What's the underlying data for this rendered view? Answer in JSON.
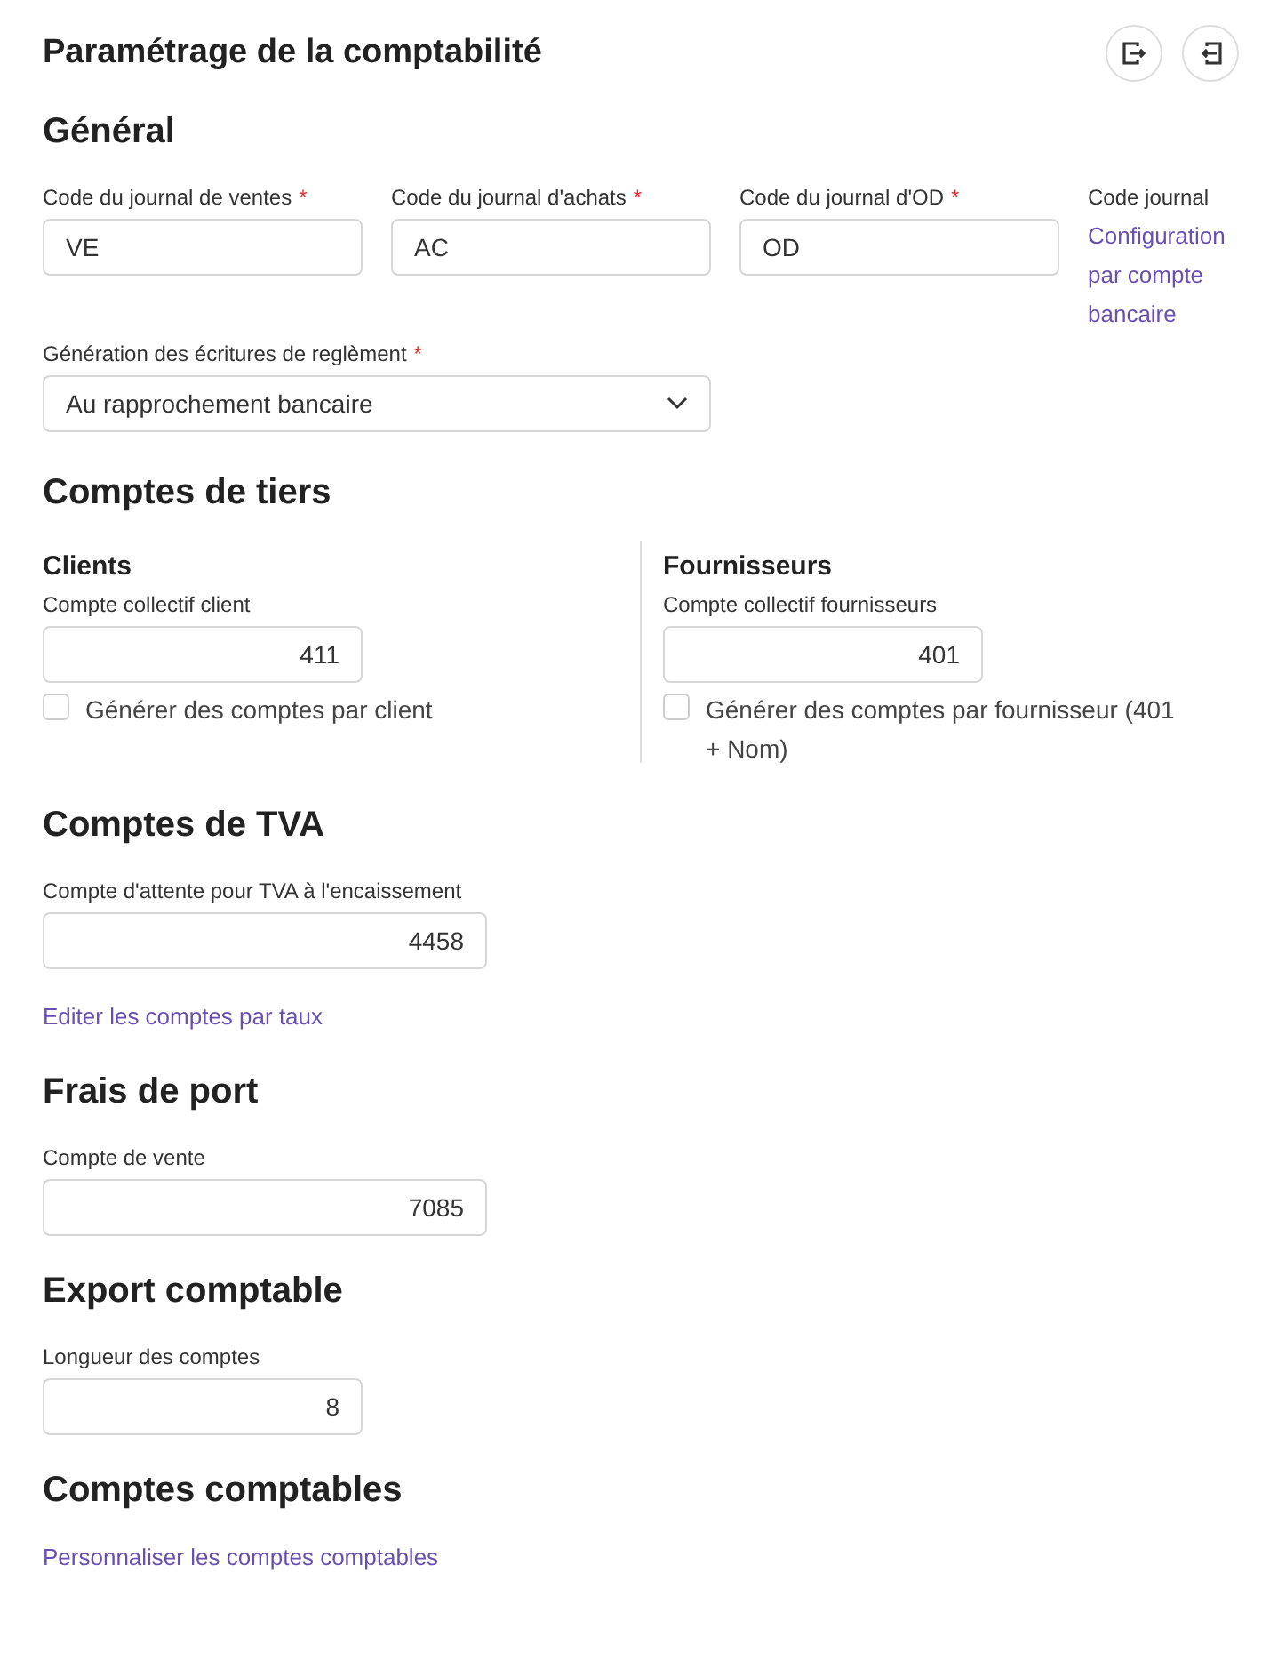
{
  "title": "Paramétrage de la comptabilité",
  "general": {
    "heading": "Général",
    "fields": [
      {
        "label": "Code du journal de ventes",
        "required_mark": "*",
        "value": "VE"
      },
      {
        "label": "Code du journal d'achats",
        "required_mark": "*",
        "value": "AC"
      },
      {
        "label": "Code du journal d'OD",
        "required_mark": "*",
        "value": "OD"
      }
    ],
    "side": {
      "label": "Code journal",
      "link": "Configuration par compte bancaire"
    },
    "select": {
      "label": "Génération des écritures de reglèment",
      "required_mark": "*",
      "value": "Au rapprochement bancaire"
    }
  },
  "third_party": {
    "heading": "Comptes de tiers",
    "columns": [
      {
        "heading": "Clients",
        "field_label": "Compte collectif client",
        "value": "411",
        "checkbox_label": "Générer des comptes par client",
        "checked": false
      },
      {
        "heading": "Fournisseurs",
        "field_label": "Compte collectif fournisseurs",
        "value": "401",
        "checkbox_label": "Générer des comptes par fournisseur (401 + Nom)",
        "checked": false
      }
    ]
  },
  "vat": {
    "heading": "Comptes de TVA",
    "field": {
      "label": "Compte d'attente pour TVA à l'encaissement",
      "value": "4458"
    },
    "link": "Editer les comptes par taux"
  },
  "shipping": {
    "heading": "Frais de port",
    "field": {
      "label": "Compte de vente",
      "value": "7085"
    }
  },
  "export": {
    "heading": "Export comptable",
    "field": {
      "label": "Longueur des comptes",
      "value": "8"
    }
  },
  "accounts": {
    "heading": "Comptes comptables",
    "link": "Personnaliser les comptes comptables"
  }
}
